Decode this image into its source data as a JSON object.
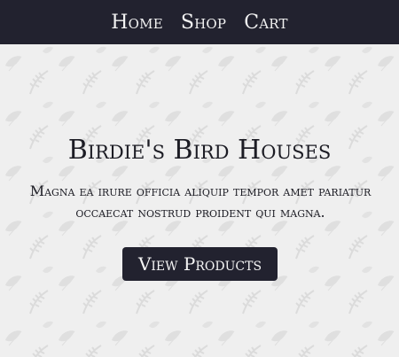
{
  "nav": {
    "home": "Home",
    "shop": "Shop",
    "cart": "Cart"
  },
  "hero": {
    "title": "Birdie's Bird Houses",
    "text": "Magna ea irure officia aliquip tempor amet pariatur occaecat nostrud proident qui magna.",
    "button_label": "View Products"
  },
  "colors": {
    "nav_bg": "#22222f",
    "page_bg": "#efefef",
    "button_bg": "#22222f",
    "text": "#1c1c24",
    "pattern": "#dcdcdc"
  },
  "icons": {
    "background_pattern": "leaf-pattern"
  }
}
